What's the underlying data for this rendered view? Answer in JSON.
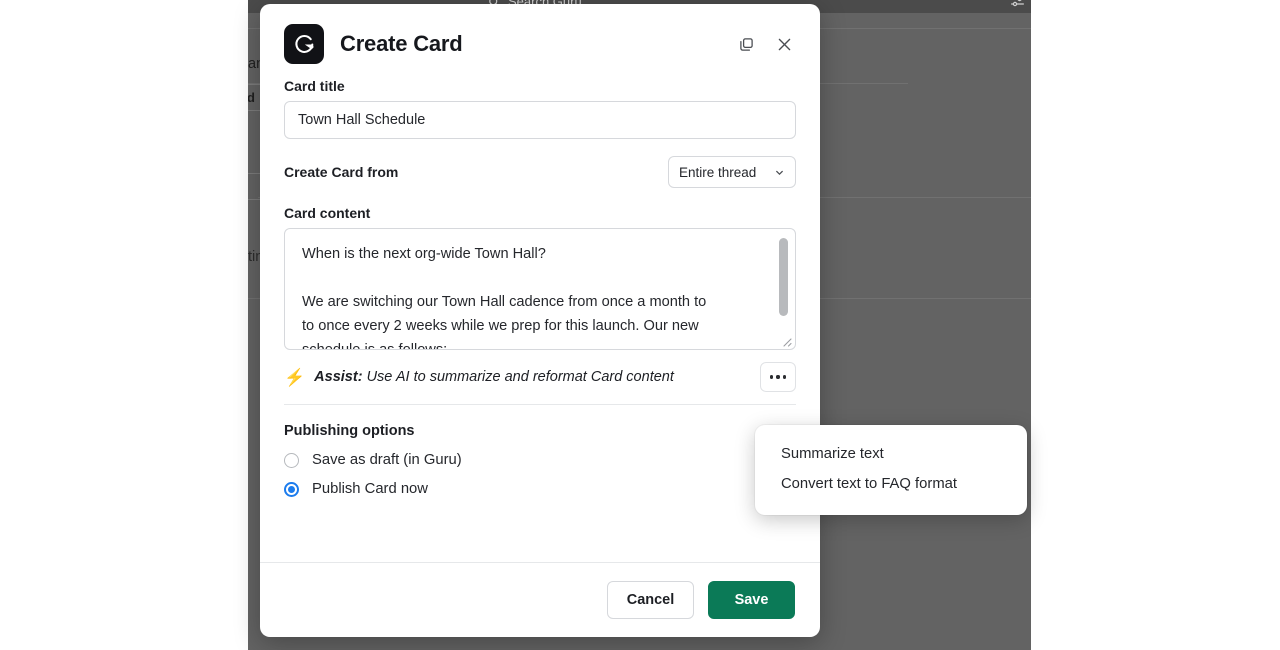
{
  "background": {
    "search_placeholder": "Search Guru",
    "search_icon": "search-icon",
    "settings_icon": "sliders-icon",
    "snippet_top": "annel. It helps to ...",
    "pill_label": "d",
    "pill_caret_icon": "chevron-down-icon",
    "small_caret_icon": "chevron-down-icon",
    "snippet_bottom": "tings.  Does anyone know how"
  },
  "modal": {
    "logo_icon": "guru-logo-icon",
    "title": "Create Card",
    "duplicate_icon": "duplicate-icon",
    "close_icon": "close-icon",
    "card_title": {
      "label": "Card title",
      "value": "Town Hall Schedule",
      "placeholder": "Card title"
    },
    "create_from": {
      "label": "Create Card from",
      "value": "Entire thread",
      "caret_icon": "chevron-down-icon",
      "options": [
        "Entire thread"
      ]
    },
    "card_content": {
      "label": "Card content",
      "value": "When is the next org-wide Town Hall?\n\nWe are switching our Town Hall cadence from once a month to\nto once every 2 weeks while we prep for this launch. Our new\nschedule is as follows:",
      "resize_icon": "resize-handle-icon",
      "scrollbar": "vertical-scrollbar"
    },
    "assist": {
      "bolt_icon": "⚡",
      "bold_prefix": "Assist:",
      "description": "Use AI to summarize and reformat Card content",
      "more_icon": "ellipsis-icon"
    },
    "publishing": {
      "title": "Publishing options",
      "options": [
        {
          "label": "Save as draft (in Guru)",
          "selected": false
        },
        {
          "label": "Publish Card now",
          "selected": true
        }
      ]
    },
    "footer": {
      "cancel_label": "Cancel",
      "save_label": "Save"
    }
  },
  "popup_menu": {
    "items": [
      {
        "label": "Summarize text"
      },
      {
        "label": "Convert text to FAQ format"
      }
    ]
  },
  "colors": {
    "save_green": "#0b7a57",
    "radio_blue": "#1c7ced",
    "logo_black": "#111216",
    "overlay_gray": "#636363"
  }
}
